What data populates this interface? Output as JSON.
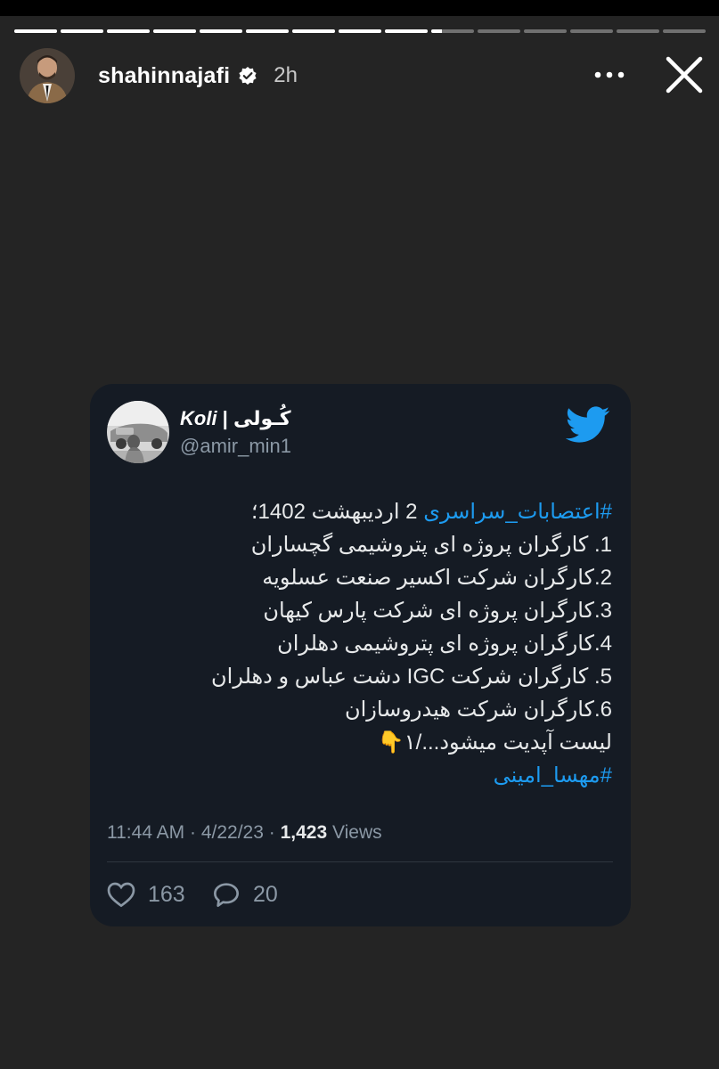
{
  "story": {
    "segment_count": 15,
    "completed_segments": 9,
    "current_segment_progress": 0.25,
    "username": "shahinnajafi",
    "posted_ago": "2h",
    "verified_icon": "verified-badge-icon",
    "more_icon": "more-horizontal-icon",
    "close_icon": "close-icon"
  },
  "tweet": {
    "display_name_latin": "Koli",
    "display_name_sep": " | ",
    "display_name_farsi": "کُـولی",
    "handle": "@amir_min1",
    "logo_icon": "twitter-bird-icon",
    "lines": {
      "l0_hashtag": "#اعتصابات_سراسری",
      "l0_rest": " 2 اردیبهشت 1402؛",
      "l1": "1. کارگران پروژه ای پتروشیمی گچساران",
      "l2": "2.کارگران شرکت اکسیر صنعت عسلویه",
      "l3": "3.کارگران پروژه ای شرکت پارس کیهان",
      "l4": "4.کارگران پروژه ای پتروشیمی دهلران",
      "l5": "5. کارگران شرکت IGC  دشت عباس و دهلران",
      "l6": "6.کارگران شرکت هیدروسازان",
      "l7": "لیست آپدیت میشود.../۱👇",
      "l8_hashtag": "#مهسا_امینی"
    },
    "time": "11:44 AM",
    "sep": " · ",
    "date": "4/22/23",
    "views_count": "1,423",
    "views_label": " Views",
    "likes": "163",
    "replies": "20",
    "like_icon": "heart-icon",
    "reply_icon": "reply-bubble-icon"
  },
  "colors": {
    "background": "#242424",
    "card": "#151b24",
    "link": "#1d9bf0",
    "twitter_blue": "#1d9bf0",
    "muted": "#8b98a5"
  }
}
